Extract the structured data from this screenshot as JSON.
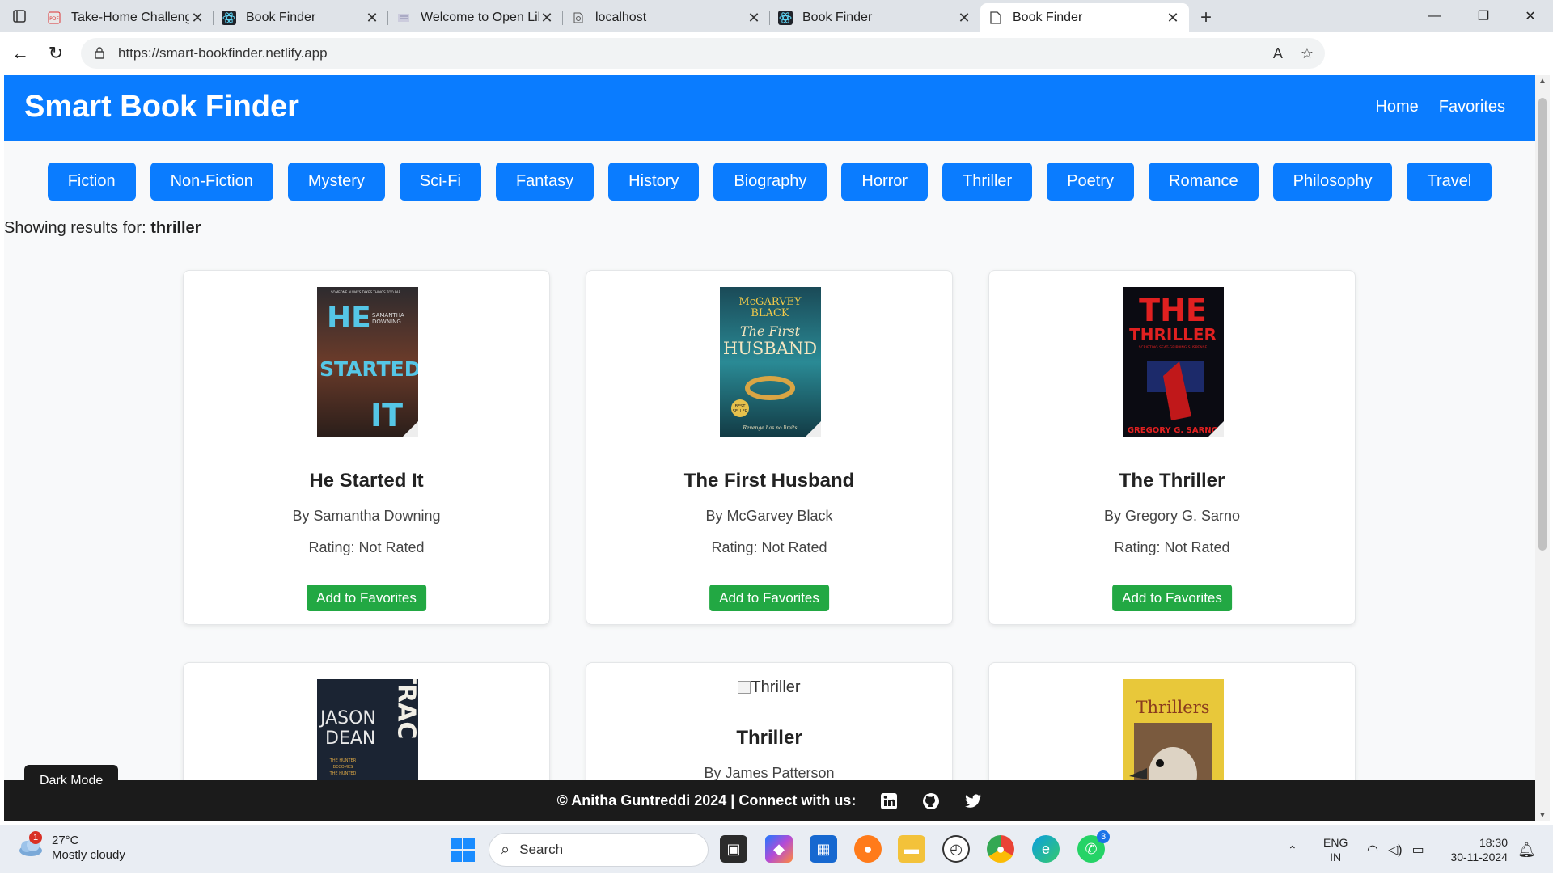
{
  "browser": {
    "tabs": [
      {
        "title": "Take-Home Challenge for UI",
        "icon": "pdf-icon",
        "active": false
      },
      {
        "title": "Book Finder",
        "icon": "react-icon",
        "active": false
      },
      {
        "title": "Welcome to Open Library | C",
        "icon": "openlibrary-icon",
        "active": false
      },
      {
        "title": "localhost",
        "icon": "globe-icon",
        "active": false
      },
      {
        "title": "Book Finder",
        "icon": "react-icon",
        "active": false
      },
      {
        "title": "Book Finder",
        "icon": "page-icon",
        "active": true
      }
    ],
    "url": "https://smart-bookfinder.netlify.app"
  },
  "page": {
    "brand": "Smart Book Finder",
    "nav": {
      "home": "Home",
      "favorites": "Favorites"
    },
    "genres": [
      "Fiction",
      "Non-Fiction",
      "Mystery",
      "Sci-Fi",
      "Fantasy",
      "History",
      "Biography",
      "Horror",
      "Thriller",
      "Poetry",
      "Romance",
      "Philosophy",
      "Travel"
    ],
    "results_label": "Showing results for:",
    "results_query": "thriller",
    "books": [
      {
        "title": "He Started It",
        "author": "By Samantha Downing",
        "rating": "Rating: Not Rated",
        "button": "Add to Favorites",
        "cover_color": "#3b2a24"
      },
      {
        "title": "The First Husband",
        "author": "By McGarvey Black",
        "rating": "Rating: Not Rated",
        "button": "Add to Favorites",
        "cover_color": "#1a6f7c"
      },
      {
        "title": "The Thriller",
        "author": "By Gregory G. Sarno",
        "rating": "Rating: Not Rated",
        "button": "Add to Favorites",
        "cover_color": "#0c0c14"
      },
      {
        "title": "",
        "author": "",
        "rating": "",
        "button": "",
        "cover_color": "#1b2433"
      },
      {
        "title": "Thriller",
        "author": "By James Patterson",
        "rating": "",
        "button": "",
        "broken_alt": "Thriller"
      },
      {
        "title": "",
        "author": "",
        "rating": "",
        "button": "",
        "cover_color": "#e8c83a"
      }
    ],
    "footer_text": "© Anitha Guntreddi 2024 | Connect with us:",
    "social": [
      "linkedin-icon",
      "github-icon",
      "twitter-icon"
    ],
    "dark_mode_label": "Dark Mode"
  },
  "covers": {
    "he_started_it": {
      "tagline": "SOMEONE ALWAYS TAKES THINGS TOO FAR...",
      "word1": "HE",
      "word2": "STARTED",
      "word3": "IT",
      "author1": "SAMANTHA",
      "author2": "DOWNING"
    },
    "first_husband": {
      "author1": "McGARVEY",
      "author2": "BLACK",
      "line1": "The First",
      "line2": "HUSBAND",
      "tagline": "Revenge has no limits",
      "badge1": "BEST",
      "badge2": "SELLER"
    },
    "the_thriller": {
      "line1": "THE",
      "line2": "THRILLER",
      "tagline": "SCRIPTING SEAT-GRIPPING SUSPENSE",
      "author": "GREGORY G. SARNO"
    },
    "trace": {
      "author1": "JASON",
      "author2": "DEAN",
      "word": "TRAC",
      "tagline1": "THE HUNTER",
      "tagline2": "BECOMES",
      "tagline3": "THE HUNTED"
    },
    "thrillers": {
      "title": "Thrillers"
    }
  },
  "taskbar": {
    "weather_temp": "27°C",
    "weather_desc": "Mostly cloudy",
    "weather_badge": "1",
    "search_label": "Search",
    "lang1": "ENG",
    "lang2": "IN",
    "time": "18:30",
    "date": "30-11-2024",
    "whatsapp_badge": "3"
  }
}
